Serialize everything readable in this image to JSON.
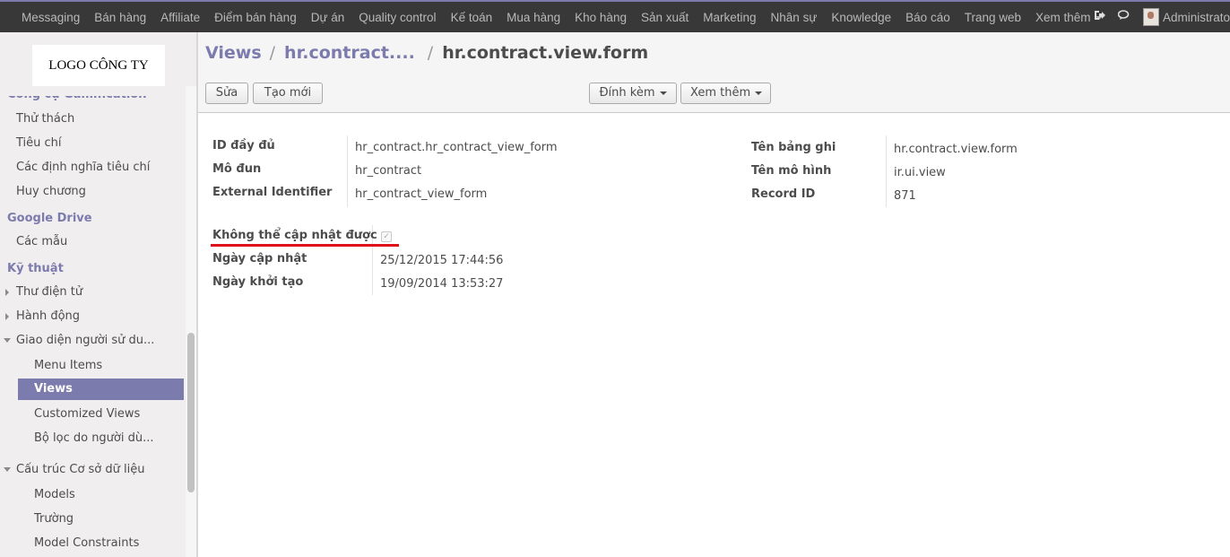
{
  "topbar": {
    "menu": [
      "Messaging",
      "Bán hàng",
      "Affiliate",
      "Điểm bán hàng",
      "Dự án",
      "Quality control",
      "Kế toán",
      "Mua hàng",
      "Kho hàng",
      "Sản xuất",
      "Marketing",
      "Nhân sự",
      "Knowledge",
      "Báo cáo",
      "Trang web",
      "Xem thêm"
    ],
    "user": "Administrato",
    "icons": [
      "sign-out-icon",
      "chat-icon",
      "avatar"
    ]
  },
  "sidebar": {
    "logo": "LOGO CÔNG TY",
    "cut_header": "Công cụ Gamification",
    "items1": [
      "Thử thách",
      "Tiêu chí",
      "Các định nghĩa tiêu chí",
      "Huy chương"
    ],
    "google_drive": "Google Drive",
    "google_items": [
      "Các mẫu"
    ],
    "technical": "Kỹ thuật",
    "tech_items": [
      "Thư điện tử",
      "Hành động",
      "Giao diện người sử du..."
    ],
    "ui_sub": [
      "Menu Items",
      "Views",
      "Customized Views",
      "Bộ lọc do người dù..."
    ],
    "db_structure": "Cấu trúc Cơ sở dữ liệu",
    "db_sub": [
      "Models",
      "Trường",
      "Model Constraints"
    ]
  },
  "breadcrumb": {
    "views": "Views",
    "contract": "hr.contract....",
    "current": "hr.contract.view.form",
    "sep": "/"
  },
  "toolbar": {
    "edit": "Sửa",
    "create": "Tạo mới",
    "attach": "Đính kèm",
    "more": "Xem thêm"
  },
  "form": {
    "left": [
      {
        "label": "ID đầy đủ",
        "value": "hr_contract.hr_contract_view_form"
      },
      {
        "label": "Mô đun",
        "value": "hr_contract"
      },
      {
        "label": "External Identifier",
        "value": "hr_contract_view_form"
      }
    ],
    "right": [
      {
        "label": "Tên bảng ghi",
        "value": "hr.contract.view.form"
      },
      {
        "label": "Tên mô hình",
        "value": "ir.ui.view"
      },
      {
        "label": "Record ID",
        "value": "871"
      }
    ],
    "noupdate_label": "Không thể cập nhật được",
    "noupdate_checked": true,
    "updated_label": "Ngày cập nhật",
    "updated_value": "25/12/2015 17:44:56",
    "created_label": "Ngày khởi tạo",
    "created_value": "19/09/2014 13:53:27"
  },
  "colors": {
    "accent": "#7c7bad",
    "topbar": "#383838",
    "annotation": "#e0101a"
  }
}
